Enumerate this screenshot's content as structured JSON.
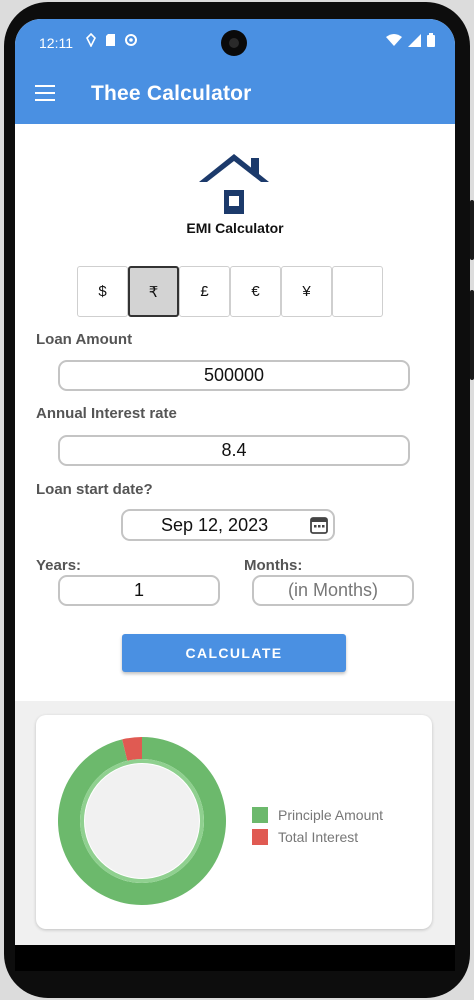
{
  "status": {
    "time": "12:11"
  },
  "appbar": {
    "title": "Thee Calculator"
  },
  "logo": {
    "title": "EMI Calculator"
  },
  "currencies": [
    {
      "symbol": "$",
      "selected": false
    },
    {
      "symbol": "₹",
      "selected": true
    },
    {
      "symbol": "£",
      "selected": false
    },
    {
      "symbol": "€",
      "selected": false
    },
    {
      "symbol": "¥",
      "selected": false
    },
    {
      "symbol": "",
      "selected": false
    }
  ],
  "form": {
    "loan_amount_label": "Loan Amount",
    "loan_amount_value": "500000",
    "interest_label": "Annual Interest rate",
    "interest_value": "8.4",
    "start_date_label": "Loan start date?",
    "start_date_value": "Sep 12, 2023",
    "years_label": "Years:",
    "years_value": "1",
    "months_label": "Months:",
    "months_placeholder": "(in Months)",
    "calculate_label": "CALCULATE"
  },
  "chart": {
    "legend": [
      {
        "name": "Principle Amount",
        "color": "#6cb96c"
      },
      {
        "name": "Total Interest",
        "color": "#e05a52"
      }
    ],
    "principal_share": 0.962,
    "interest_share": 0.038
  },
  "colors": {
    "primary": "#4a90e2",
    "logo": "#1c3a6b"
  }
}
